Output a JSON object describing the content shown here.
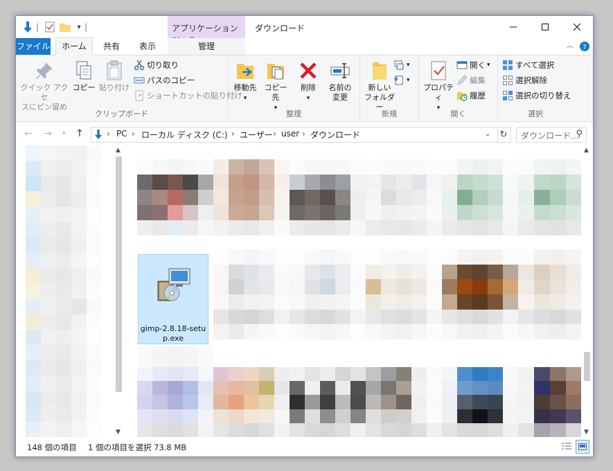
{
  "window": {
    "title": "ダウンロード",
    "context_tab_group": "アプリケーション ツール",
    "controls": {
      "minimize": "—",
      "maximize": "☐",
      "close": "✕"
    }
  },
  "tabs": {
    "file": "ファイル",
    "home": "ホーム",
    "share": "共有",
    "view": "表示",
    "manage": "管理"
  },
  "ribbon": {
    "clipboard": {
      "group_label": "クリップボード",
      "pin_line1": "クイック アクセ",
      "pin_line2": "スにピン留め",
      "copy": "コピー",
      "paste": "貼り付け",
      "cut": "切り取り",
      "copy_path": "パスのコピー",
      "paste_shortcut": "ショートカットの貼り付け"
    },
    "organize": {
      "group_label": "整理",
      "move_to": "移動先",
      "copy_to": "コピー先",
      "delete": "削除",
      "rename_line1": "名前の",
      "rename_line2": "変更"
    },
    "new": {
      "group_label": "新規",
      "new_folder_line1": "新しい",
      "new_folder_line2": "フォルダー"
    },
    "open": {
      "group_label": "開く",
      "properties": "プロパティ",
      "open": "開く",
      "edit": "編集",
      "history": "履歴"
    },
    "select": {
      "group_label": "選択",
      "select_all": "すべて選択",
      "select_none": "選択解除",
      "invert": "選択の切り替え"
    }
  },
  "address": {
    "crumbs": [
      "PC",
      "ローカル ディスク (C:)",
      "ユーザー",
      "user",
      "ダウンロード"
    ],
    "search_placeholder": "ダウンロード..."
  },
  "files": {
    "selected_file_line1": "gimp-2.8.18-setu",
    "selected_file_line2": "p.exe"
  },
  "status": {
    "item_count": "148 個の項目",
    "selection": "1 個の項目を選択  73.8 MB"
  }
}
